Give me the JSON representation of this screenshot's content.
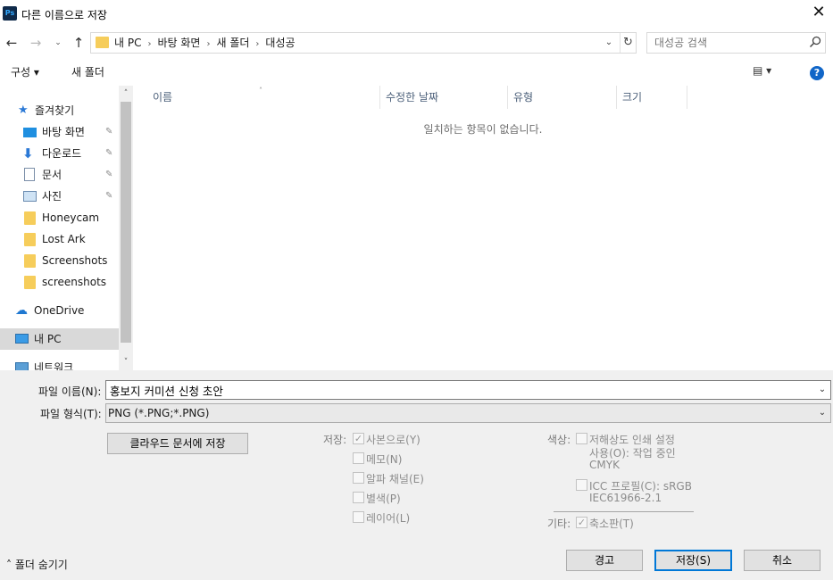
{
  "window": {
    "app_icon": "Ps",
    "title": "다른 이름으로 저장",
    "close_glyph": "✕"
  },
  "nav_buttons": {
    "back": "←",
    "forward": "→",
    "recent": "⌄",
    "up": "↑"
  },
  "address": {
    "crumbs": [
      "내 PC",
      "바탕 화면",
      "새 폴더",
      "대성공"
    ],
    "separator": "›",
    "dropdown": "⌄",
    "refresh": "↻"
  },
  "search": {
    "placeholder": "대성공 검색"
  },
  "toolbar": {
    "organize": "구성 ▾",
    "new_folder": "새 폴더",
    "view_glyph": "▤ ▾",
    "help": "?"
  },
  "nav_pane": {
    "items": [
      {
        "label": "즐겨찾기"
      },
      {
        "label": "바탕 화면"
      },
      {
        "label": "다운로드"
      },
      {
        "label": "문서"
      },
      {
        "label": "사진"
      },
      {
        "label": "Honeycam"
      },
      {
        "label": "Lost Ark"
      },
      {
        "label": "Screenshots"
      },
      {
        "label": "screenshots"
      },
      {
        "label": "OneDrive"
      },
      {
        "label": "내 PC"
      },
      {
        "label": "네트워크"
      }
    ],
    "pin_glyph": "📌",
    "scroll_up": "˄",
    "scroll_down": "˅"
  },
  "file_list": {
    "columns": [
      "이름",
      "수정한 날짜",
      "유형",
      "크기"
    ],
    "sort_glyph": "˄",
    "empty_message": "일치하는 항목이 없습니다."
  },
  "form": {
    "filename_label": "파일 이름(N):",
    "filename_value": "홍보지 커미션 신청 초안",
    "filetype_label": "파일 형식(T):",
    "filetype_value": "PNG (*.PNG;*.PNG)",
    "chevron": "⌄"
  },
  "cloud_button": "클라우드 문서에 저장",
  "save_options": {
    "group_label": "저장:",
    "items": [
      {
        "label": "사본으로(Y)",
        "checked": true
      },
      {
        "label": "메모(N)",
        "checked": false
      },
      {
        "label": "알파 채널(E)",
        "checked": false
      },
      {
        "label": "별색(P)",
        "checked": false
      },
      {
        "label": "레이어(L)",
        "checked": false
      }
    ]
  },
  "color_options": {
    "group_label": "색상:",
    "proof_line1": "저해상도 인쇄 설정",
    "proof_line2": "사용(O): 작업 중인",
    "proof_line3": "CMYK",
    "icc_line1": "ICC 프로필(C): sRGB",
    "icc_line2": "IEC61966-2.1"
  },
  "other_options": {
    "group_label": "기타:",
    "thumbnail": "축소판(T)",
    "thumbnail_checked": true
  },
  "checkmark": "✓",
  "buttons": {
    "warning": "경고",
    "save": "저장(S)",
    "cancel": "취소"
  },
  "hide_folders": "˄  폴더 숨기기"
}
